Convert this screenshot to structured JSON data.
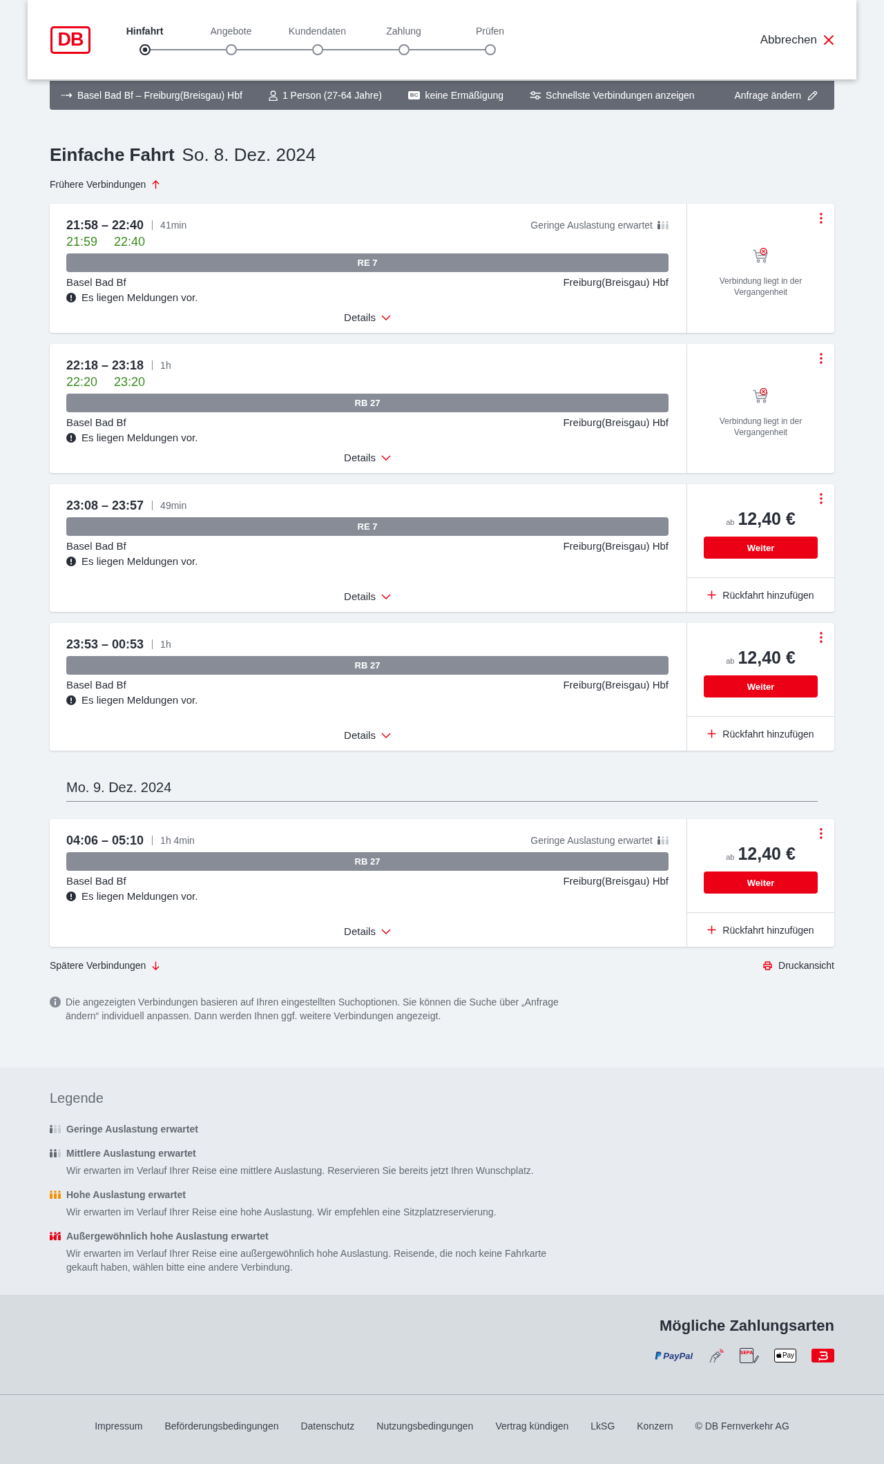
{
  "header": {
    "logo": "DB",
    "steps": [
      {
        "label": "Hinfahrt",
        "selected": true
      },
      {
        "label": "Angebote",
        "selected": false
      },
      {
        "label": "Kundendaten",
        "selected": false
      },
      {
        "label": "Zahlung",
        "selected": false
      },
      {
        "label": "Prüfen",
        "selected": false
      }
    ],
    "cancel": "Abbrechen"
  },
  "search_summary": {
    "route": "Basel Bad Bf – Freiburg(Breisgau) Hbf",
    "travelers": "1 Person (27-64 Jahre)",
    "discount_badge": "BC",
    "discount": "keine Ermäßigung",
    "filter": "Schnellste Verbindungen anzeigen",
    "edit": "Anfrage ändern"
  },
  "heading": {
    "title": "Einfache Fahrt",
    "date": "So. 8. Dez. 2024"
  },
  "earlier_link": "Frühere Verbindungen",
  "results": [
    {
      "kind": "connection",
      "times": "21:58 – 22:40",
      "duration": "41min",
      "occupancy": {
        "kind": "low",
        "label": "Geringe Auslastung erwartet"
      },
      "realtime": [
        "21:59",
        "22:40"
      ],
      "train": "RE 7",
      "from": "Basel Bad Bf",
      "to": "Freiburg(Breisgau) Hbf",
      "notice": "Es liegen Meldungen vor.",
      "details": "Details",
      "offer": {
        "kind": "past",
        "message": "Verbindung liegt in der Vergangenheit"
      }
    },
    {
      "kind": "connection",
      "times": "22:18 – 23:18",
      "duration": "1h",
      "realtime": [
        "22:20",
        "23:20"
      ],
      "train": "RB 27",
      "from": "Basel Bad Bf",
      "to": "Freiburg(Breisgau) Hbf",
      "notice": "Es liegen Meldungen vor.",
      "details": "Details",
      "offer": {
        "kind": "past",
        "message": "Verbindung liegt in der Vergangenheit"
      }
    },
    {
      "kind": "connection",
      "times": "23:08 – 23:57",
      "duration": "49min",
      "train": "RE 7",
      "from": "Basel Bad Bf",
      "to": "Freiburg(Breisgau) Hbf",
      "notice": "Es liegen Meldungen vor.",
      "details": "Details",
      "offer": {
        "kind": "price",
        "prefix": "ab",
        "price": "12,40 €",
        "button": "Weiter",
        "return": "Rückfahrt hinzufügen"
      }
    },
    {
      "kind": "connection",
      "times": "23:53 – 00:53",
      "duration": "1h",
      "train": "RB 27",
      "from": "Basel Bad Bf",
      "to": "Freiburg(Breisgau) Hbf",
      "notice": "Es liegen Meldungen vor.",
      "details": "Details",
      "offer": {
        "kind": "price",
        "prefix": "ab",
        "price": "12,40 €",
        "button": "Weiter",
        "return": "Rückfahrt hinzufügen"
      }
    },
    {
      "kind": "date_divider",
      "date": "Mo. 9. Dez. 2024"
    },
    {
      "kind": "connection",
      "times": "04:06 – 05:10",
      "duration": "1h 4min",
      "occupancy": {
        "kind": "low",
        "label": "Geringe Auslastung erwartet"
      },
      "train": "RB 27",
      "from": "Basel Bad Bf",
      "to": "Freiburg(Breisgau) Hbf",
      "notice": "Es liegen Meldungen vor.",
      "details": "Details",
      "offer": {
        "kind": "price",
        "prefix": "ab",
        "price": "12,40 €",
        "button": "Weiter",
        "return": "Rückfahrt hinzufügen"
      }
    }
  ],
  "later_link": "Spätere Verbindungen",
  "print_link": "Druckansicht",
  "info": "Die angezeigten Verbindungen basieren auf Ihren eingestellten Suchoptionen. Sie können die Suche über „Anfrage ändern“ individuell anpassen. Dann werden Ihnen ggf. weitere Verbindungen angezeigt.",
  "legend": {
    "title": "Legende",
    "items": [
      {
        "kind": "low",
        "label": "Geringe Auslastung erwartet"
      },
      {
        "kind": "medium",
        "label": "Mittlere Auslastung erwartet",
        "description": "Wir erwarten im Verlauf Ihrer Reise eine mittlere Auslastung. Reservieren Sie bereits jetzt Ihren Wunschplatz."
      },
      {
        "kind": "high",
        "label": "Hohe Auslastung erwartet",
        "description": "Wir erwarten im Verlauf Ihrer Reise eine hohe Auslastung. Wir empfehlen eine Sitzplatzreservierung."
      },
      {
        "kind": "exceptional",
        "label": "Außergewöhnlich hohe Auslastung erwartet",
        "description": "Wir erwarten im Verlauf Ihrer Reise eine außergewöhnlich hohe Auslastung. Reisende, die noch keine Fahrkarte gekauft haben, wählen bitte eine andere Verbindung."
      }
    ]
  },
  "payment": {
    "title": "Mögliche Zahlungsarten",
    "methods": [
      {
        "kind": "paypal",
        "label": "PayPal"
      },
      {
        "kind": "contactless"
      },
      {
        "kind": "sepa",
        "label": "SEPA"
      },
      {
        "kind": "apple_pay",
        "label": "Pay"
      },
      {
        "kind": "db_bonus"
      }
    ]
  },
  "footer_links": [
    "Impressum",
    "Beförderungsbedingungen",
    "Datenschutz",
    "Nutzungsbedingungen",
    "Vertrag kündigen",
    "LkSG",
    "Konzern",
    "© DB Fernverkehr AG"
  ]
}
